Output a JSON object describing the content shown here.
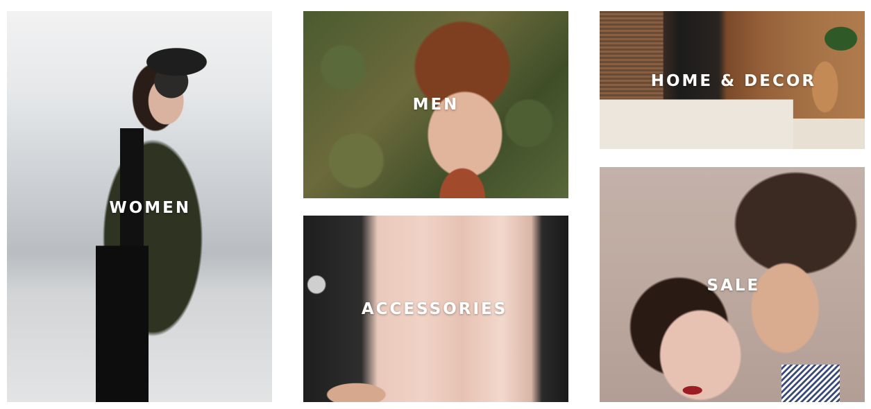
{
  "categories": {
    "women": {
      "label": "WOMEN"
    },
    "men": {
      "label": "MEN"
    },
    "accessories": {
      "label": "ACCESSORIES"
    },
    "home_decor": {
      "label": "HOME & DECOR"
    },
    "sale": {
      "label": "SALE"
    }
  }
}
